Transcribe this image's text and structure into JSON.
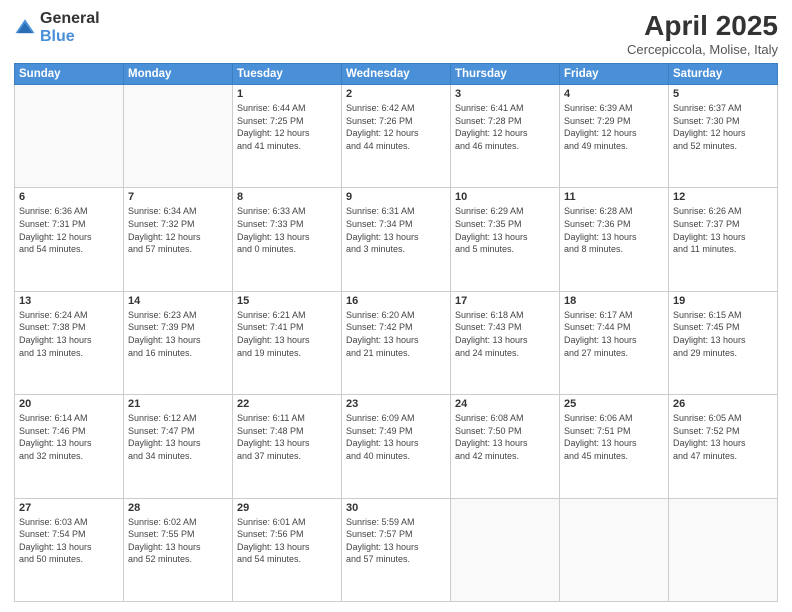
{
  "header": {
    "logo_general": "General",
    "logo_blue": "Blue",
    "month_title": "April 2025",
    "location": "Cercepiccola, Molise, Italy"
  },
  "weekdays": [
    "Sunday",
    "Monday",
    "Tuesday",
    "Wednesday",
    "Thursday",
    "Friday",
    "Saturday"
  ],
  "weeks": [
    [
      {
        "day": "",
        "info": ""
      },
      {
        "day": "",
        "info": ""
      },
      {
        "day": "1",
        "info": "Sunrise: 6:44 AM\nSunset: 7:25 PM\nDaylight: 12 hours\nand 41 minutes."
      },
      {
        "day": "2",
        "info": "Sunrise: 6:42 AM\nSunset: 7:26 PM\nDaylight: 12 hours\nand 44 minutes."
      },
      {
        "day": "3",
        "info": "Sunrise: 6:41 AM\nSunset: 7:28 PM\nDaylight: 12 hours\nand 46 minutes."
      },
      {
        "day": "4",
        "info": "Sunrise: 6:39 AM\nSunset: 7:29 PM\nDaylight: 12 hours\nand 49 minutes."
      },
      {
        "day": "5",
        "info": "Sunrise: 6:37 AM\nSunset: 7:30 PM\nDaylight: 12 hours\nand 52 minutes."
      }
    ],
    [
      {
        "day": "6",
        "info": "Sunrise: 6:36 AM\nSunset: 7:31 PM\nDaylight: 12 hours\nand 54 minutes."
      },
      {
        "day": "7",
        "info": "Sunrise: 6:34 AM\nSunset: 7:32 PM\nDaylight: 12 hours\nand 57 minutes."
      },
      {
        "day": "8",
        "info": "Sunrise: 6:33 AM\nSunset: 7:33 PM\nDaylight: 13 hours\nand 0 minutes."
      },
      {
        "day": "9",
        "info": "Sunrise: 6:31 AM\nSunset: 7:34 PM\nDaylight: 13 hours\nand 3 minutes."
      },
      {
        "day": "10",
        "info": "Sunrise: 6:29 AM\nSunset: 7:35 PM\nDaylight: 13 hours\nand 5 minutes."
      },
      {
        "day": "11",
        "info": "Sunrise: 6:28 AM\nSunset: 7:36 PM\nDaylight: 13 hours\nand 8 minutes."
      },
      {
        "day": "12",
        "info": "Sunrise: 6:26 AM\nSunset: 7:37 PM\nDaylight: 13 hours\nand 11 minutes."
      }
    ],
    [
      {
        "day": "13",
        "info": "Sunrise: 6:24 AM\nSunset: 7:38 PM\nDaylight: 13 hours\nand 13 minutes."
      },
      {
        "day": "14",
        "info": "Sunrise: 6:23 AM\nSunset: 7:39 PM\nDaylight: 13 hours\nand 16 minutes."
      },
      {
        "day": "15",
        "info": "Sunrise: 6:21 AM\nSunset: 7:41 PM\nDaylight: 13 hours\nand 19 minutes."
      },
      {
        "day": "16",
        "info": "Sunrise: 6:20 AM\nSunset: 7:42 PM\nDaylight: 13 hours\nand 21 minutes."
      },
      {
        "day": "17",
        "info": "Sunrise: 6:18 AM\nSunset: 7:43 PM\nDaylight: 13 hours\nand 24 minutes."
      },
      {
        "day": "18",
        "info": "Sunrise: 6:17 AM\nSunset: 7:44 PM\nDaylight: 13 hours\nand 27 minutes."
      },
      {
        "day": "19",
        "info": "Sunrise: 6:15 AM\nSunset: 7:45 PM\nDaylight: 13 hours\nand 29 minutes."
      }
    ],
    [
      {
        "day": "20",
        "info": "Sunrise: 6:14 AM\nSunset: 7:46 PM\nDaylight: 13 hours\nand 32 minutes."
      },
      {
        "day": "21",
        "info": "Sunrise: 6:12 AM\nSunset: 7:47 PM\nDaylight: 13 hours\nand 34 minutes."
      },
      {
        "day": "22",
        "info": "Sunrise: 6:11 AM\nSunset: 7:48 PM\nDaylight: 13 hours\nand 37 minutes."
      },
      {
        "day": "23",
        "info": "Sunrise: 6:09 AM\nSunset: 7:49 PM\nDaylight: 13 hours\nand 40 minutes."
      },
      {
        "day": "24",
        "info": "Sunrise: 6:08 AM\nSunset: 7:50 PM\nDaylight: 13 hours\nand 42 minutes."
      },
      {
        "day": "25",
        "info": "Sunrise: 6:06 AM\nSunset: 7:51 PM\nDaylight: 13 hours\nand 45 minutes."
      },
      {
        "day": "26",
        "info": "Sunrise: 6:05 AM\nSunset: 7:52 PM\nDaylight: 13 hours\nand 47 minutes."
      }
    ],
    [
      {
        "day": "27",
        "info": "Sunrise: 6:03 AM\nSunset: 7:54 PM\nDaylight: 13 hours\nand 50 minutes."
      },
      {
        "day": "28",
        "info": "Sunrise: 6:02 AM\nSunset: 7:55 PM\nDaylight: 13 hours\nand 52 minutes."
      },
      {
        "day": "29",
        "info": "Sunrise: 6:01 AM\nSunset: 7:56 PM\nDaylight: 13 hours\nand 54 minutes."
      },
      {
        "day": "30",
        "info": "Sunrise: 5:59 AM\nSunset: 7:57 PM\nDaylight: 13 hours\nand 57 minutes."
      },
      {
        "day": "",
        "info": ""
      },
      {
        "day": "",
        "info": ""
      },
      {
        "day": "",
        "info": ""
      }
    ]
  ]
}
